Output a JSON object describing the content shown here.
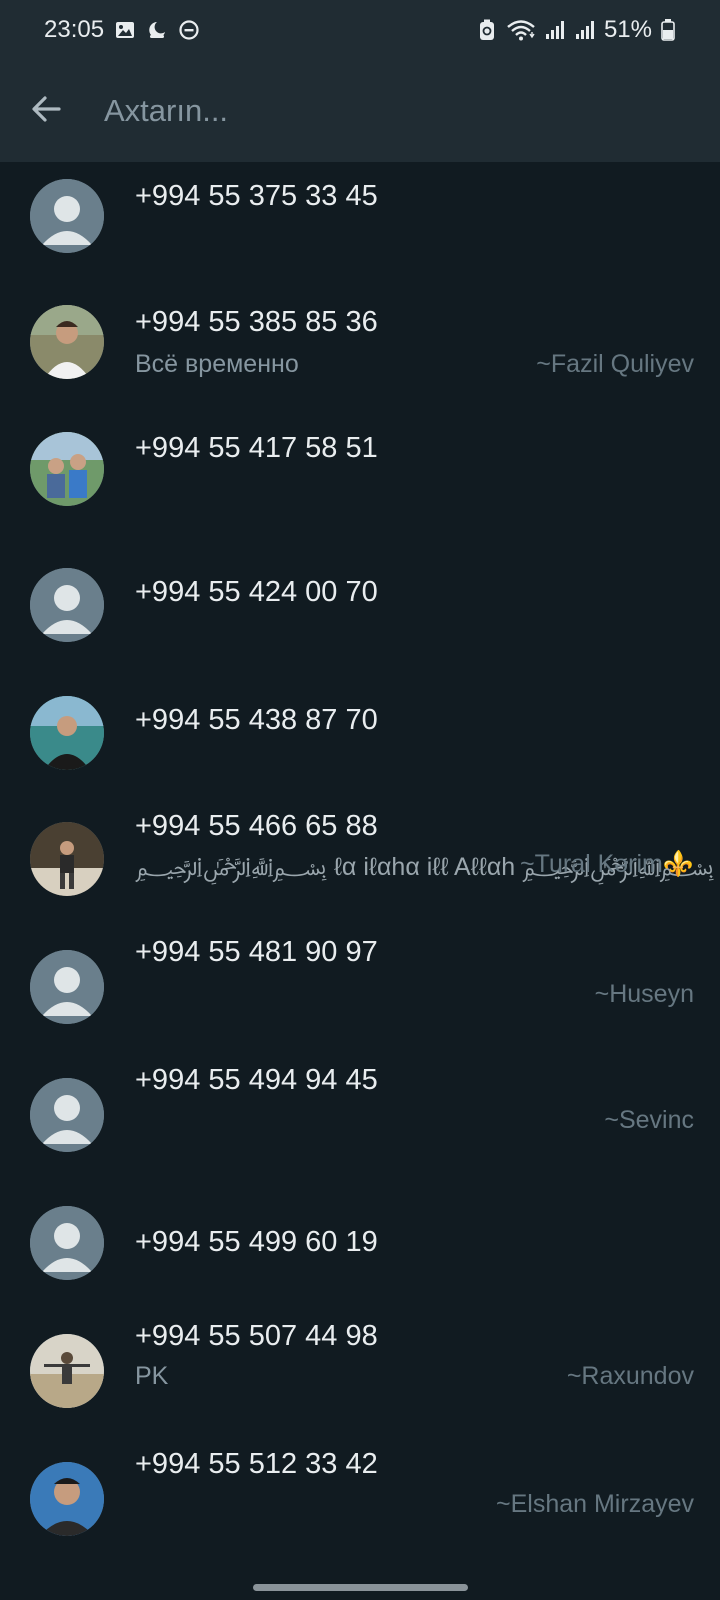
{
  "status_bar": {
    "time": "23:05",
    "battery": "51%",
    "left_icons": [
      "image-icon",
      "night-mode-icon",
      "do-not-disturb-icon"
    ],
    "right_icons": [
      "battery-saver-icon",
      "wifi-icon",
      "signal-icon",
      "signal-icon",
      "battery-icon"
    ]
  },
  "app_bar": {
    "back_icon": "arrow-back-icon",
    "search_placeholder": "Axtarın..."
  },
  "contacts": [
    {
      "phone": "+994 55 375 33 45",
      "about": "",
      "pushname": "",
      "avatar": "default"
    },
    {
      "phone": "+994 55 385 85 36",
      "about": "Всё временно",
      "pushname": "~Fazil Quliyev",
      "avatar": "photo"
    },
    {
      "phone": "+994 55 417 58 51",
      "about": "",
      "pushname": "",
      "avatar": "photo"
    },
    {
      "phone": "+994 55 424 00 70",
      "about": "",
      "pushname": "",
      "avatar": "default"
    },
    {
      "phone": "+994 55 438 87 70",
      "about": "",
      "pushname": "",
      "avatar": "photo"
    },
    {
      "phone": "+994 55 466 65 88",
      "about": "﷽ ℓα iℓαhα iℓℓ Aℓℓαh ﷽",
      "pushname": "~Tural Kərim⚜️",
      "avatar": "photo"
    },
    {
      "phone": "+994 55 481 90 97",
      "about": "",
      "pushname": "~Huseyn",
      "avatar": "default"
    },
    {
      "phone": "+994 55 494 94 45",
      "about": "",
      "pushname": "~Sevinc",
      "avatar": "default"
    },
    {
      "phone": "+994 55 499 60 19",
      "about": "",
      "pushname": "",
      "avatar": "default"
    },
    {
      "phone": "+994 55 507 44 98",
      "about": "PK",
      "pushname": "~Raxundov",
      "avatar": "photo"
    },
    {
      "phone": "+994 55 512 33 42",
      "about": "",
      "pushname": "~Elshan Mirzayev",
      "avatar": "photo"
    }
  ]
}
